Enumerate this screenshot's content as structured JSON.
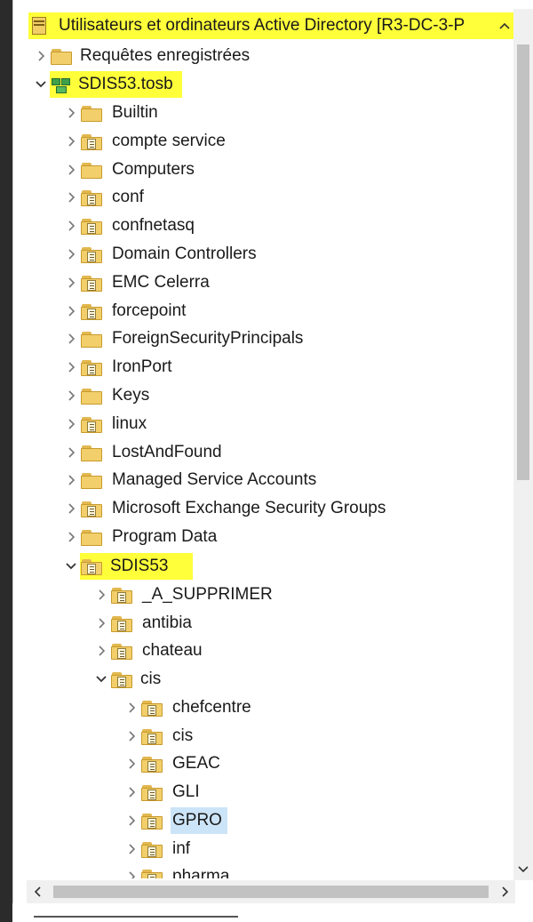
{
  "window": {
    "root_label": "Utilisateurs et ordinateurs Active Directory [R3-DC-3-P",
    "highlight_color": "#ffff3a",
    "selection_color": "#cce4f7"
  },
  "tree": {
    "saved_queries": "Requêtes enregistrées",
    "domain": "SDIS53.tosb",
    "domain_children": [
      {
        "label": "Builtin",
        "icon": "folder-icon"
      },
      {
        "label": "compte service",
        "icon": "ou-folder-icon"
      },
      {
        "label": "Computers",
        "icon": "folder-icon"
      },
      {
        "label": "conf",
        "icon": "ou-folder-icon"
      },
      {
        "label": "confnetasq",
        "icon": "ou-folder-icon"
      },
      {
        "label": "Domain Controllers",
        "icon": "ou-folder-icon"
      },
      {
        "label": "EMC Celerra",
        "icon": "ou-folder-icon"
      },
      {
        "label": "forcepoint",
        "icon": "ou-folder-icon"
      },
      {
        "label": "ForeignSecurityPrincipals",
        "icon": "folder-icon"
      },
      {
        "label": "IronPort",
        "icon": "ou-folder-icon"
      },
      {
        "label": "Keys",
        "icon": "folder-icon"
      },
      {
        "label": "linux",
        "icon": "ou-folder-icon"
      },
      {
        "label": "LostAndFound",
        "icon": "folder-icon"
      },
      {
        "label": "Managed Service Accounts",
        "icon": "folder-icon"
      },
      {
        "label": "Microsoft Exchange Security Groups",
        "icon": "ou-folder-icon"
      },
      {
        "label": "Program Data",
        "icon": "folder-icon"
      }
    ],
    "sdis53": "SDIS53",
    "sdis53_children": [
      {
        "label": "_A_SUPPRIMER"
      },
      {
        "label": "antibia"
      },
      {
        "label": "chateau"
      }
    ],
    "cis": "cis",
    "cis_children": [
      {
        "label": "chefcentre"
      },
      {
        "label": "cis"
      },
      {
        "label": "GEAC"
      },
      {
        "label": "GLI"
      },
      {
        "label": "GPRO"
      },
      {
        "label": "inf"
      },
      {
        "label": "pharma"
      }
    ]
  }
}
